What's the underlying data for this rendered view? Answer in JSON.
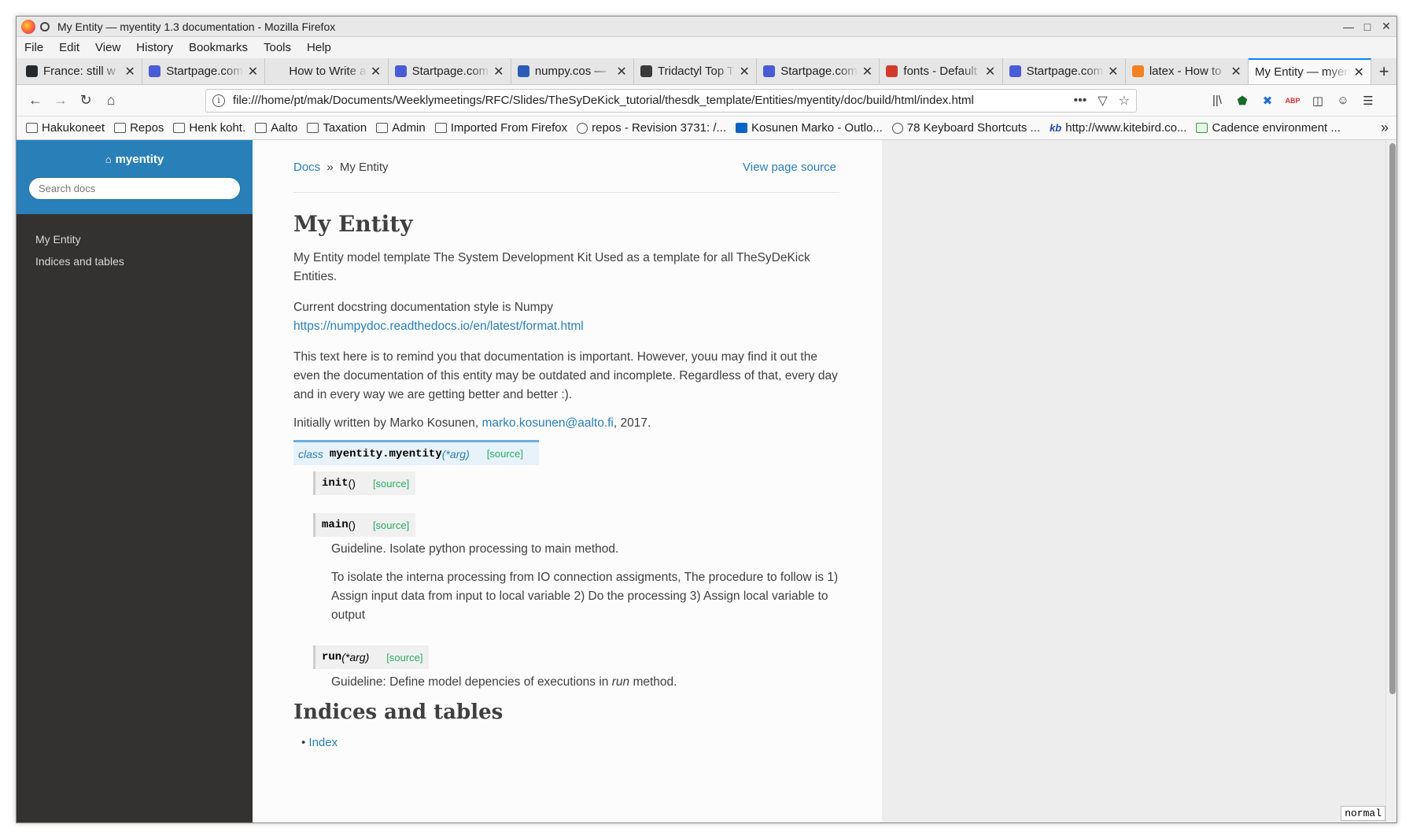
{
  "window": {
    "title": "My Entity — myentity 1.3 documentation - Mozilla Firefox",
    "controls": [
      "—",
      "□",
      "✕"
    ]
  },
  "menu": [
    "File",
    "Edit",
    "View",
    "History",
    "Bookmarks",
    "Tools",
    "Help"
  ],
  "tabs": [
    {
      "label": "France: still w",
      "icon": "github-icon",
      "color": "#24292e"
    },
    {
      "label": "Startpage.com",
      "icon": "startpage-icon",
      "color": "#4a5bd6"
    },
    {
      "label": "How to Write a Gi",
      "icon": "blank-icon",
      "color": "#e6e6e6"
    },
    {
      "label": "Startpage.com",
      "icon": "startpage-icon",
      "color": "#4a5bd6"
    },
    {
      "label": "numpy.cos —",
      "icon": "numpy-icon",
      "color": "#2a5bb5"
    },
    {
      "label": "Tridactyl Top T",
      "icon": "tridactyl-icon",
      "color": "#3a3a3a"
    },
    {
      "label": "Startpage.com",
      "icon": "startpage-icon",
      "color": "#4a5bd6"
    },
    {
      "label": "fonts - Default",
      "icon": "braces-icon",
      "color": "#d23b2b"
    },
    {
      "label": "Startpage.com",
      "icon": "startpage-icon",
      "color": "#4a5bd6"
    },
    {
      "label": "latex - How to",
      "icon": "stackexchange-icon",
      "color": "#f48024"
    },
    {
      "label": "My Entity — myen",
      "icon": "none",
      "color": "#f9f9f9",
      "active": true
    }
  ],
  "url": "file:///home/pt/mak/Documents/Weeklymeetings/RFC/Slides/TheSyDeKick_tutorial/thesdk_template/Entities/myentity/doc/build/html/index.html",
  "bookmarks": [
    {
      "label": "Hakukoneet",
      "icon": "folder-icon"
    },
    {
      "label": "Repos",
      "icon": "folder-icon"
    },
    {
      "label": "Henk koht.",
      "icon": "folder-icon"
    },
    {
      "label": "Aalto",
      "icon": "folder-icon"
    },
    {
      "label": "Taxation",
      "icon": "folder-icon"
    },
    {
      "label": "Admin",
      "icon": "folder-icon"
    },
    {
      "label": "Imported From Firefox",
      "icon": "folder-icon"
    },
    {
      "label": "repos - Revision 3731: /...",
      "icon": "globe-icon"
    },
    {
      "label": "Kosunen Marko - Outlo...",
      "icon": "outlook-icon"
    },
    {
      "label": "78 Keyboard Shortcuts ...",
      "icon": "globe-icon"
    },
    {
      "label": "http://www.kitebird.co...",
      "icon": "kitebird-icon"
    },
    {
      "label": "Cadence environment ...",
      "icon": "cadence-icon"
    }
  ],
  "sidebar": {
    "brand": "myentity",
    "search_placeholder": "Search docs",
    "items": [
      "My Entity",
      "Indices and tables"
    ]
  },
  "breadcrumb": {
    "docs": "Docs",
    "sep": "»",
    "current": "My Entity",
    "view_source": "View page source"
  },
  "page": {
    "title": "My Entity",
    "p1": "My Entity model template The System Development Kit Used as a template for all TheSyDeKick Entities.",
    "p2_text": "Current docstring documentation style is Numpy ",
    "p2_link": "https://numpydoc.readthedocs.io/en/latest/format.html",
    "p3": "This text here is to remind you that documentation is important. However, youu may find it out the even the documentation of this entity may be outdated and incomplete. Regardless of that, every day and in every way we are getting better and better :).",
    "p4_text": "Initially written by Marko Kosunen, ",
    "p4_link": "marko.kosunen@aalto.fi",
    "p4_tail": ", 2017.",
    "class_sig": {
      "keyword": "class",
      "name": "myentity.myentity",
      "args": "(*arg)",
      "source": "[source]"
    },
    "methods": [
      {
        "name": "init",
        "args": "()",
        "source": "[source]"
      },
      {
        "name": "main",
        "args": "()",
        "source": "[source]"
      },
      {
        "name": "run",
        "args": "(*arg)",
        "source": "[source]"
      }
    ],
    "main_doc1": "Guideline. Isolate python processing to main method.",
    "main_doc2": "To isolate the interna processing from IO connection assigments, The procedure to follow is 1) Assign input data from input to local variable 2) Do the processing 3) Assign local variable to output",
    "run_doc_pre": "Guideline: Define model depencies of executions in ",
    "run_doc_em": "run",
    "run_doc_post": " method.",
    "indices_title": "Indices and tables",
    "index_link": "Index"
  },
  "status_mode": "normal",
  "colors": {
    "sidebar_blue": "#2980b9",
    "sidebar_dark": "#343131",
    "link": "#2980b9",
    "source_green": "#27ae60",
    "active_tab_accent": "#0a84ff"
  }
}
